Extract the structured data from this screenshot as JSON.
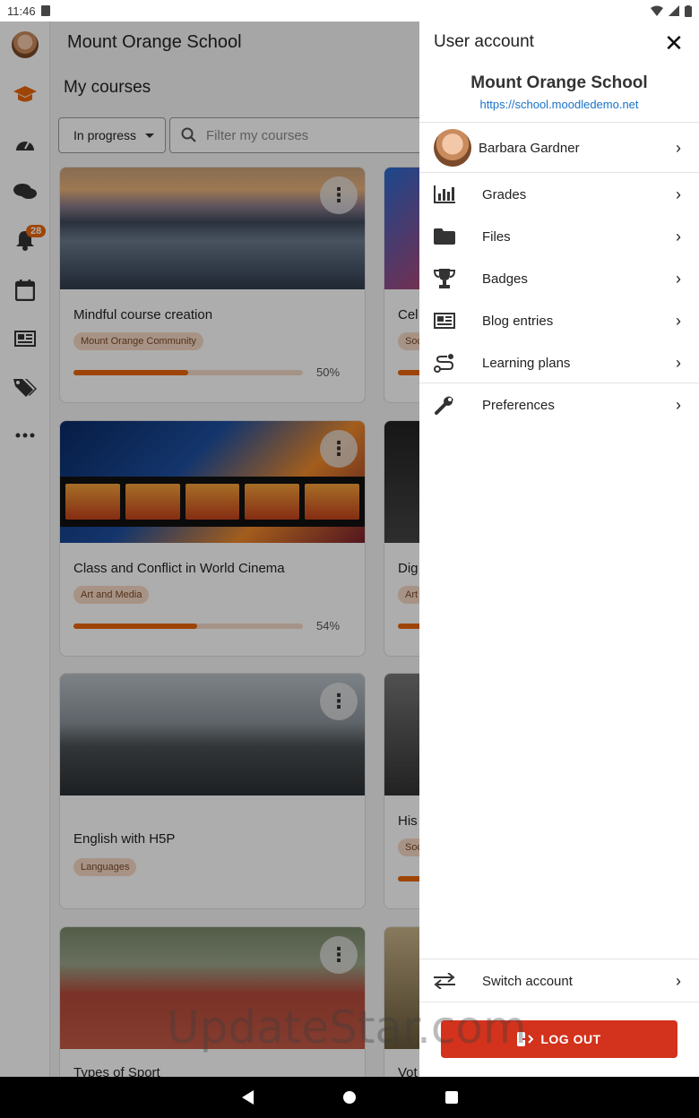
{
  "status_bar": {
    "time": "11:46"
  },
  "rail": {
    "notifications_badge": "28"
  },
  "main": {
    "app_title": "Mount Orange School",
    "page_title": "My courses",
    "filter": {
      "selected": "In progress",
      "placeholder": "Filter my courses"
    },
    "courses": [
      {
        "title": "Mindful course creation",
        "category": "Mount Orange Community",
        "progress_label": "50%",
        "progress": 0.5
      },
      {
        "title": "Class and Conflict in World Cinema",
        "category": "Art and Media",
        "progress_label": "54%",
        "progress": 0.54
      },
      {
        "title": "English with H5P",
        "category": "Languages"
      },
      {
        "title": "Types of Sport"
      }
    ],
    "courses_right": [
      {
        "title": "Cel",
        "category": "Soc"
      },
      {
        "title": "Dig",
        "category": "Art"
      },
      {
        "title": "His",
        "category": "Soc"
      },
      {
        "title": "Vot"
      }
    ]
  },
  "drawer": {
    "header": "User account",
    "site_name": "Mount Orange School",
    "site_url": "https://school.moodledemo.net",
    "user_name": "Barbara Gardner",
    "items": [
      {
        "label": "Grades",
        "icon": "bar-chart-icon"
      },
      {
        "label": "Files",
        "icon": "folder-icon"
      },
      {
        "label": "Badges",
        "icon": "trophy-icon"
      },
      {
        "label": "Blog entries",
        "icon": "newspaper-icon"
      },
      {
        "label": "Learning plans",
        "icon": "route-icon"
      },
      {
        "label": "Preferences",
        "icon": "wrench-icon"
      }
    ],
    "switch_account": "Switch account",
    "logout": "LOG OUT"
  },
  "watermark": "UpdateStar.com",
  "colors": {
    "accent": "#e8650a",
    "logout": "#d3321c",
    "link": "#1a73c8"
  }
}
